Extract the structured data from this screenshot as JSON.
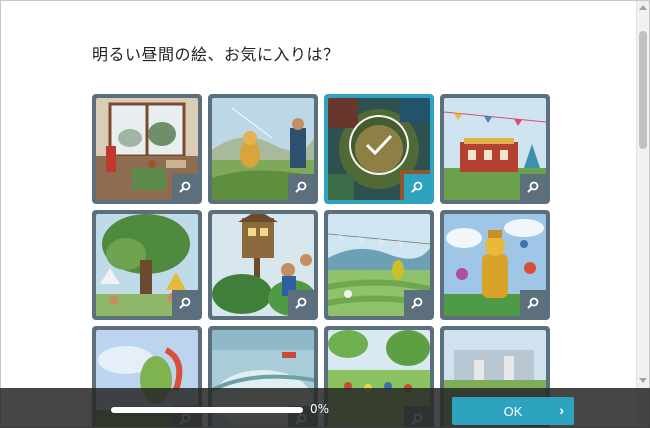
{
  "question": {
    "text": "明るい昼間の絵、お気に入りは？"
  },
  "tiles": [
    {
      "id": "art-1",
      "selected": false,
      "icon": "search-icon"
    },
    {
      "id": "art-2",
      "selected": false,
      "icon": "search-icon"
    },
    {
      "id": "art-3",
      "selected": true,
      "icon": "search-icon"
    },
    {
      "id": "art-4",
      "selected": false,
      "icon": "search-icon"
    },
    {
      "id": "art-5",
      "selected": false,
      "icon": "search-icon"
    },
    {
      "id": "art-6",
      "selected": false,
      "icon": "search-icon"
    },
    {
      "id": "art-7",
      "selected": false,
      "icon": "search-icon"
    },
    {
      "id": "art-8",
      "selected": false,
      "icon": "search-icon"
    },
    {
      "id": "art-9",
      "selected": false,
      "icon": "search-icon"
    },
    {
      "id": "art-10",
      "selected": false,
      "icon": "search-icon"
    },
    {
      "id": "art-11",
      "selected": false,
      "icon": "search-icon"
    },
    {
      "id": "art-12",
      "selected": false,
      "icon": "search-icon"
    }
  ],
  "progress": {
    "value": 0,
    "label": "0%"
  },
  "ok_button": {
    "label": "OK",
    "icon": "chevron-right-icon"
  },
  "colors": {
    "accent": "#2ea3c0",
    "tile_frame": "#5c6f7c",
    "bar": "#282828"
  }
}
